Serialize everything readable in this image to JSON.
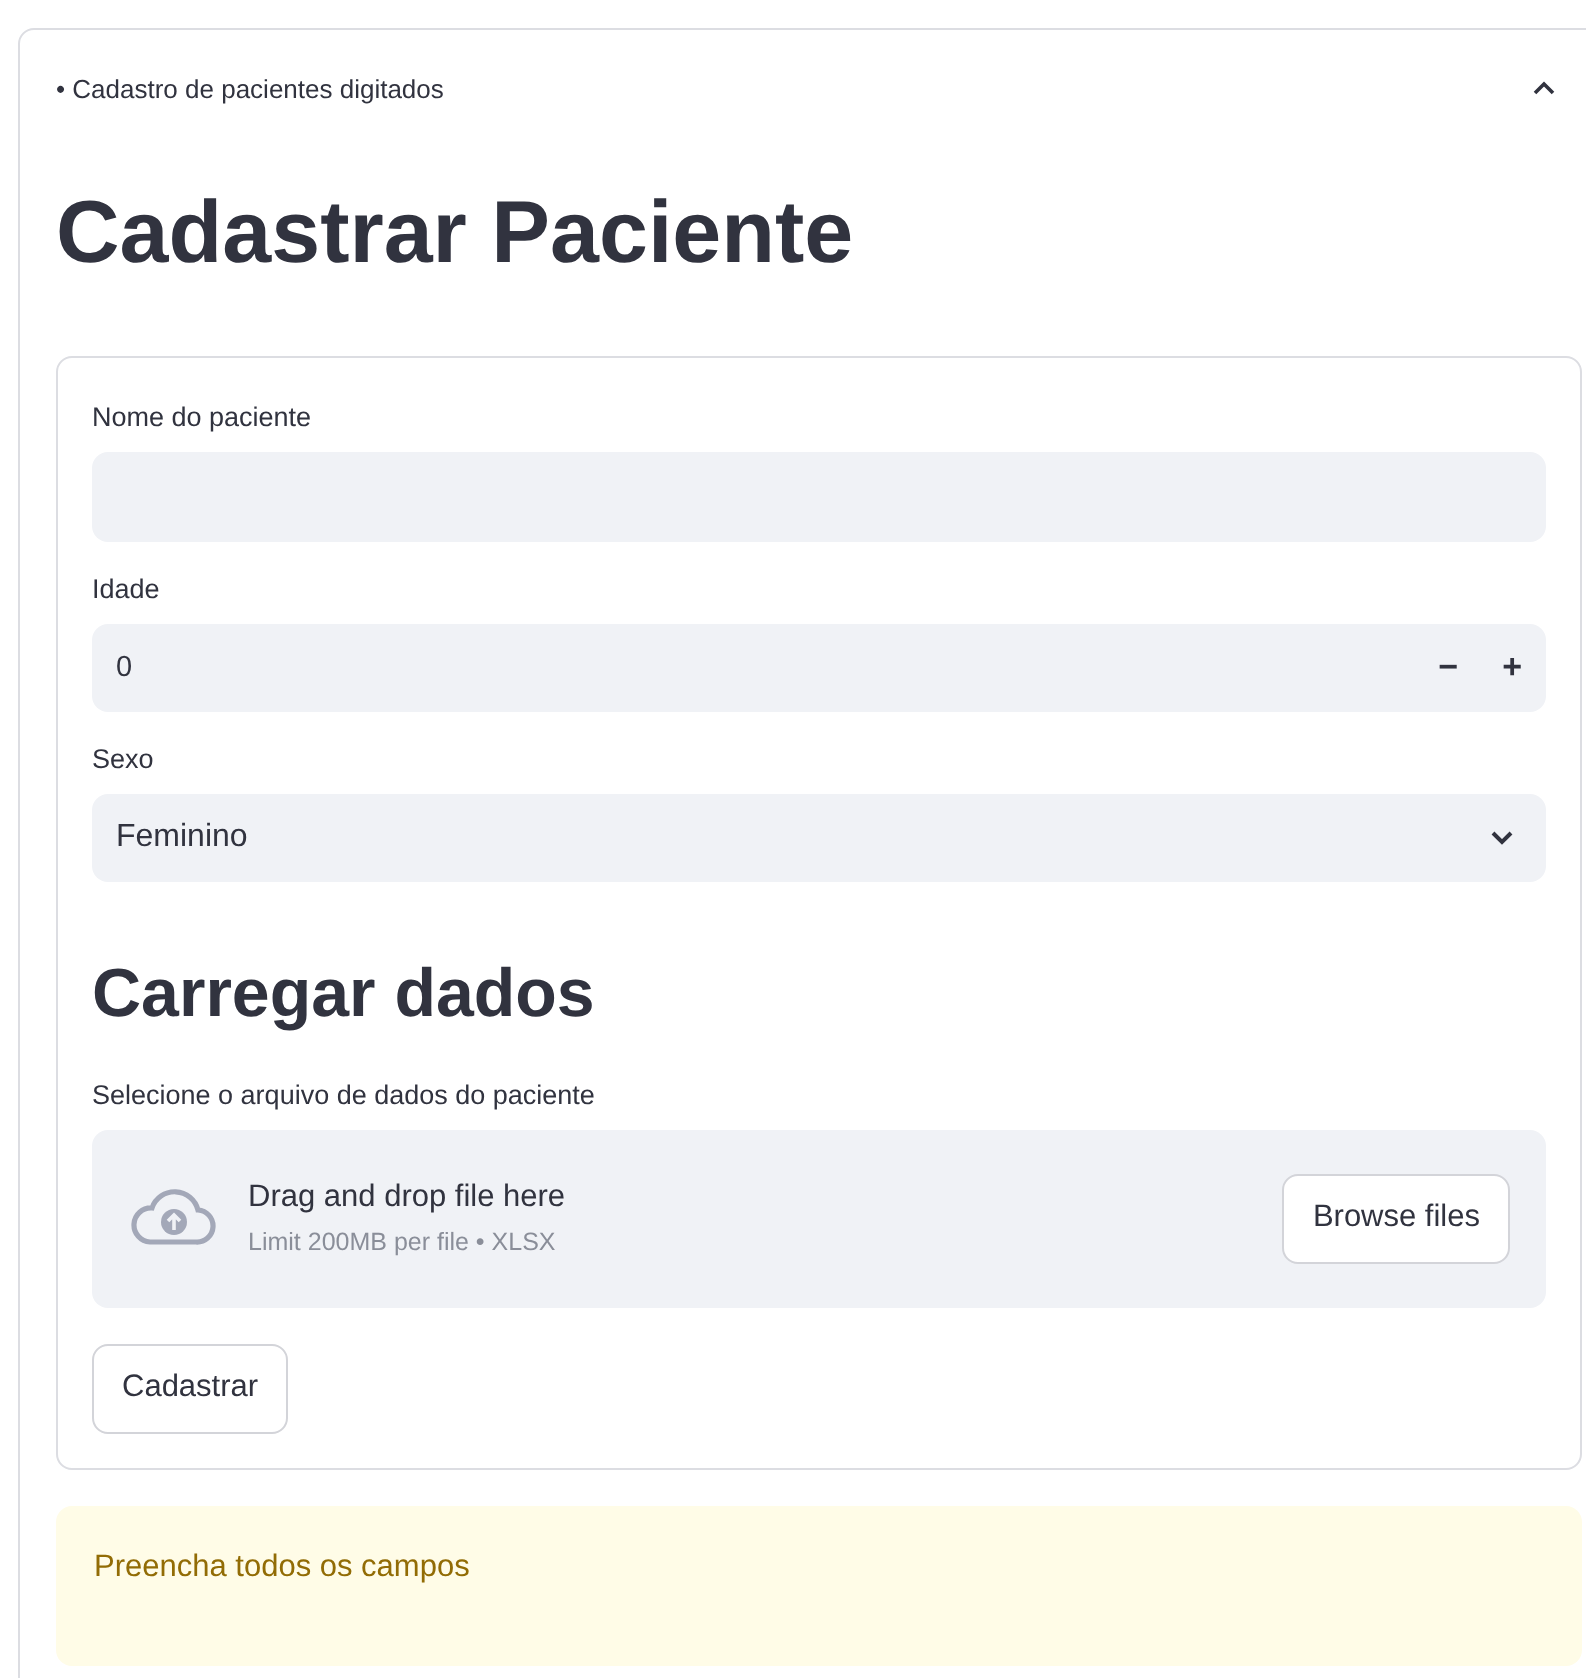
{
  "expander": {
    "label": "• Cadastro de pacientes digitados",
    "expanded": true
  },
  "title": "Cadastrar Paciente",
  "form": {
    "fields": [
      {
        "kind": "text",
        "label": "Nome do paciente"
      },
      {
        "kind": "number",
        "label": "Idade",
        "value": "0",
        "minus": "−",
        "plus": "+"
      },
      {
        "kind": "select",
        "label": "Sexo",
        "value": "Feminino"
      }
    ],
    "upload_heading": "Carregar dados",
    "upload": {
      "label": "Selecione o arquivo de dados do paciente",
      "title": "Drag and drop file here",
      "hint": "Limit 200MB per file • XLSX",
      "button": "Browse files"
    },
    "submit": "Cadastrar"
  },
  "warning": "Preencha todos os campos"
}
